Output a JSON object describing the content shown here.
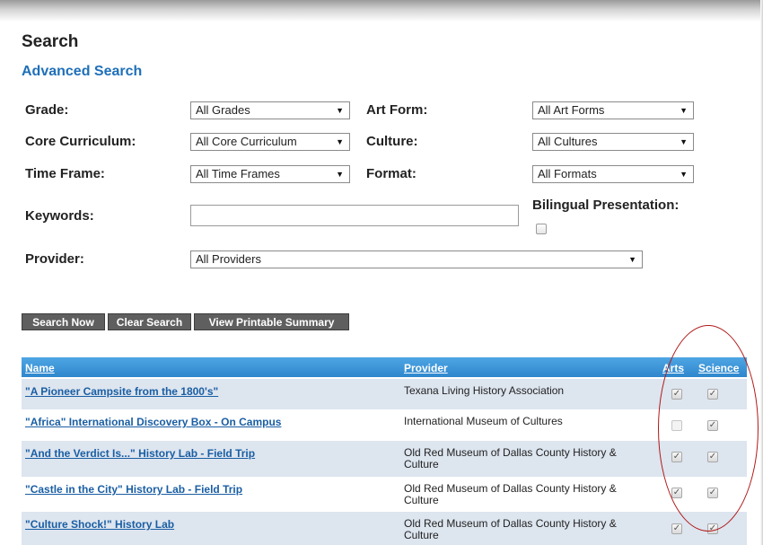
{
  "page": {
    "title": "Search",
    "subtitle": "Advanced Search"
  },
  "filters": {
    "grade": {
      "label": "Grade:",
      "value": "All Grades"
    },
    "art_form": {
      "label": "Art Form:",
      "value": "All Art Forms"
    },
    "core_curriculum": {
      "label": "Core Curriculum:",
      "value": "All Core Curriculum"
    },
    "culture": {
      "label": "Culture:",
      "value": "All Cultures"
    },
    "time_frame": {
      "label": "Time Frame:",
      "value": "All Time Frames"
    },
    "format": {
      "label": "Format:",
      "value": "All Formats"
    },
    "keywords": {
      "label": "Keywords:",
      "value": ""
    },
    "bilingual": {
      "label": "Bilingual Presentation:",
      "checked": false
    },
    "provider": {
      "label": "Provider:",
      "value": "All Providers"
    }
  },
  "icons": {
    "dropdown": "triangle-down-icon",
    "checked": "check-icon"
  },
  "buttons": {
    "search": "Search Now",
    "clear": "Clear Search",
    "printable": "View Printable Summary"
  },
  "table": {
    "columns": {
      "name": "Name",
      "provider": "Provider",
      "arts": "Arts",
      "science": "Science"
    },
    "rows": [
      {
        "name": "\"A Pioneer Campsite from the 1800's\"",
        "provider": "Texana Living History Association",
        "arts": true,
        "science": true
      },
      {
        "name": "\"Africa\" International Discovery Box - On Campus",
        "provider": "International Museum of Cultures",
        "arts": false,
        "science": true
      },
      {
        "name": "\"And the Verdict Is...\" History Lab - Field Trip",
        "provider": "Old Red Museum of Dallas County History & Culture",
        "arts": true,
        "science": true
      },
      {
        "name": "\"Castle in the City\" History Lab - Field Trip",
        "provider": "Old Red Museum of Dallas County History & Culture",
        "arts": true,
        "science": true
      },
      {
        "name": "\"Culture Shock!\" History Lab",
        "provider": "Old Red Museum of Dallas County History & Culture",
        "arts": true,
        "science": true
      }
    ]
  },
  "colors": {
    "accent": "#1e6fb8",
    "header_bar": "#2f86cc",
    "alt_row": "#dde5ef",
    "button": "#5f5f5f",
    "highlight_ellipse": "#b01818"
  }
}
